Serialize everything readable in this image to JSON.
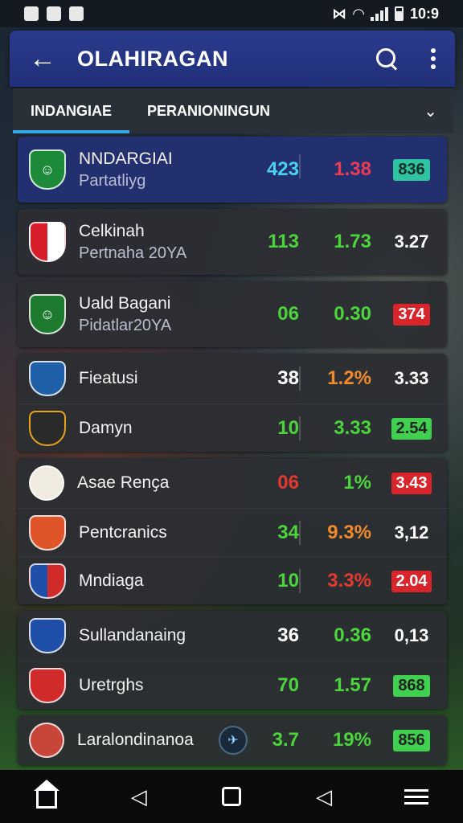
{
  "status_bar": {
    "time": "10:9"
  },
  "app_bar": {
    "title": "OLAHIRAGAN"
  },
  "tabs": [
    {
      "label": "INDANGIAE",
      "active": true
    },
    {
      "label": "PERANIONINGUN",
      "active": false
    }
  ],
  "matches": [
    {
      "name": "NNDARGIAI",
      "sub": "Partatliyg",
      "v1": "423",
      "v2": "1.38",
      "v3": "836"
    },
    {
      "name": "Celkinah",
      "sub": "Pertnaha 20YA",
      "v1": "113",
      "v2": "1.73",
      "v3": "3.27"
    },
    {
      "name": "Uald Bagani",
      "sub": "Pidatlar20YA",
      "v1": "06",
      "v2": "0.30",
      "v3": "374"
    },
    {
      "name": "Fieatusi",
      "sub": "",
      "v1": "38",
      "v2": "1.2%",
      "v3": "3.33"
    },
    {
      "name": "Damyn",
      "sub": "",
      "v1": "10",
      "v2": "3.33",
      "v3": "2.54"
    },
    {
      "name": "Asae Renҫa",
      "sub": "",
      "v1": "06",
      "v2": "1%",
      "v3": "3.43"
    },
    {
      "name": "Pentcranics",
      "sub": "",
      "v1": "34",
      "v2": "9.3%",
      "v3": "3,12"
    },
    {
      "name": "Mndiaga",
      "sub": "",
      "v1": "10",
      "v2": "3.3%",
      "v3": "2.04"
    },
    {
      "name": "Sullandanaing",
      "sub": "",
      "v1": "36",
      "v2": "0.36",
      "v3": "0,13"
    },
    {
      "name": "Uretrghs",
      "sub": "",
      "v1": "70",
      "v2": "1.57",
      "v3": "868"
    },
    {
      "name": "Laralondinanoa",
      "sub": "",
      "v1": "3.7",
      "v2": "19%",
      "v3": "856"
    }
  ],
  "colors": {
    "accent": "#38a9e8",
    "app_bar": "#2a3a8c",
    "green": "#4cd43c",
    "red": "#e23a30"
  }
}
